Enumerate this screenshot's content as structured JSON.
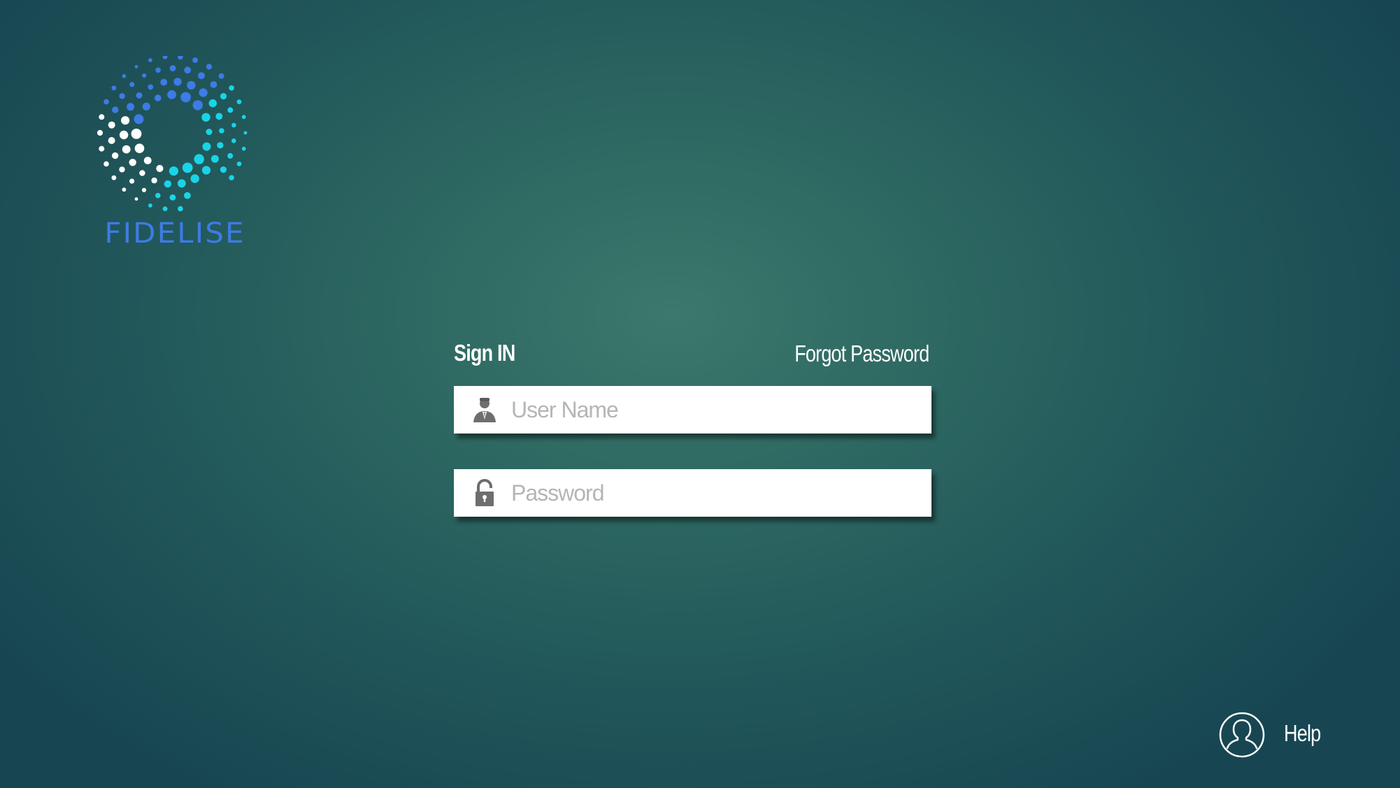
{
  "brand": {
    "name": "FIDELISE",
    "colors": {
      "blue": "#3d7be6",
      "cyan": "#19d4e8",
      "white": "#ffffff"
    }
  },
  "signin": {
    "title": "Sign IN",
    "forgot_label": "Forgot Password"
  },
  "fields": {
    "username": {
      "placeholder": "User Name",
      "value": "",
      "icon": "user-icon"
    },
    "password": {
      "placeholder": "Password",
      "value": "",
      "icon": "lock-open-icon"
    }
  },
  "help": {
    "label": "Help",
    "icon": "user-circle-icon"
  },
  "theme": {
    "background_center": "#3c786c",
    "background_edge": "#174652"
  }
}
